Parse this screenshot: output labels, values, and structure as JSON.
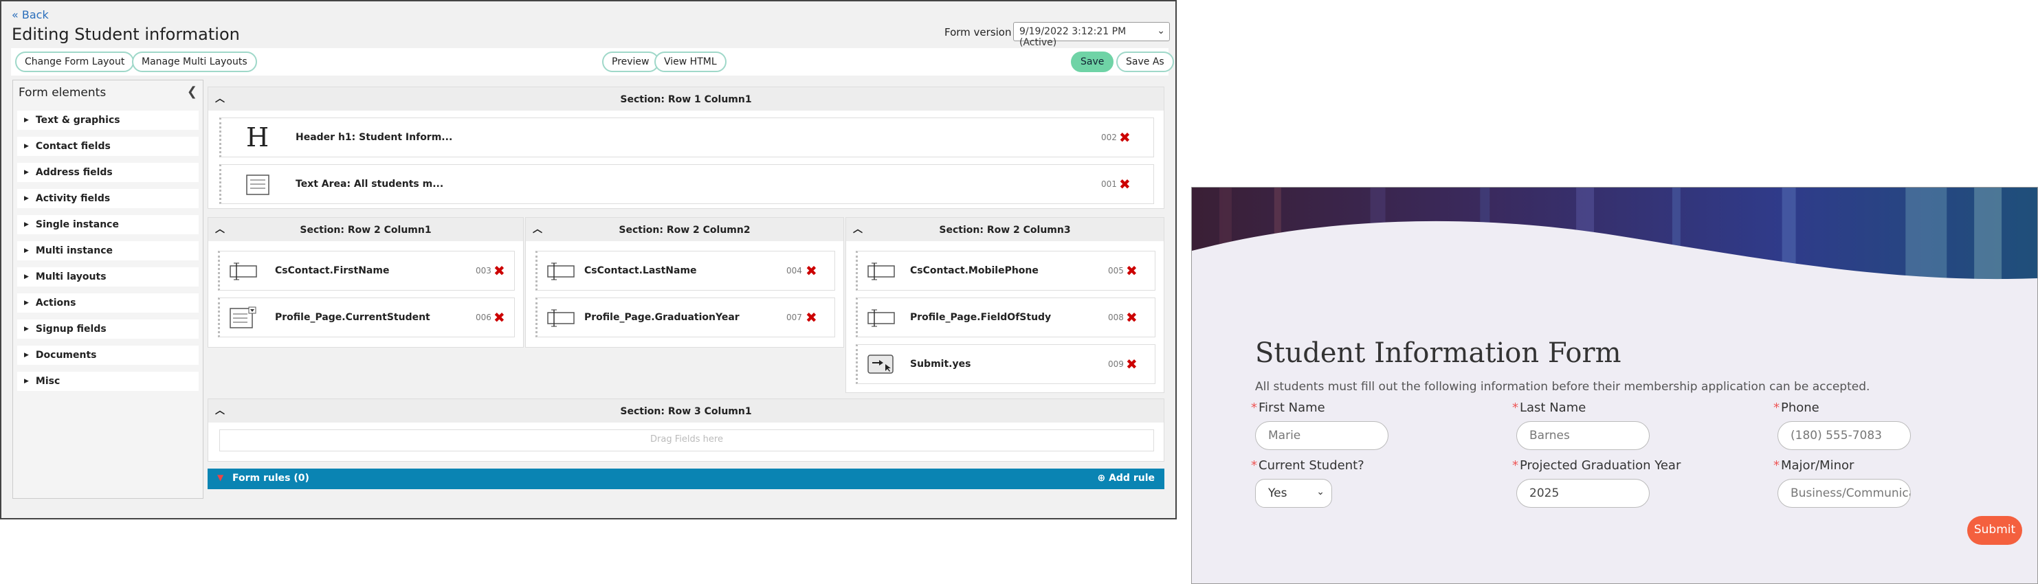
{
  "editor": {
    "back_label": "« Back",
    "title": "Editing Student information",
    "form_version_label": "Form version",
    "form_version_value": "9/19/2022 3:12:21 PM (Active)",
    "toolbar": {
      "change_layout": "Change Form Layout",
      "manage_multi": "Manage Multi Layouts",
      "preview": "Preview",
      "view_html": "View HTML",
      "save": "Save",
      "save_as": "Save As"
    },
    "sidebar": {
      "title": "Form elements",
      "items": [
        "Text & graphics",
        "Contact fields",
        "Address fields",
        "Activity fields",
        "Single instance",
        "Multi instance",
        "Multi layouts",
        "Actions",
        "Signup fields",
        "Documents",
        "Misc"
      ]
    },
    "sections": {
      "row1": {
        "title": "Section: Row 1 Column1",
        "fields": [
          {
            "name": "Header h1: Student Inform...",
            "num": "002",
            "icon": "header-icon"
          },
          {
            "name": "Text Area: All students m...",
            "num": "001",
            "icon": "text-area-icon"
          }
        ]
      },
      "row2col1": {
        "title": "Section: Row 2 Column1",
        "fields": [
          {
            "name": "CsContact.FirstName",
            "num": "003",
            "icon": "text-input-icon"
          },
          {
            "name": "Profile_Page.CurrentStudent",
            "num": "006",
            "icon": "dropdown-icon"
          }
        ]
      },
      "row2col2": {
        "title": "Section: Row 2 Column2",
        "fields": [
          {
            "name": "CsContact.LastName",
            "num": "004",
            "icon": "text-input-icon"
          },
          {
            "name": "Profile_Page.GraduationYear",
            "num": "007",
            "icon": "text-input-icon"
          }
        ]
      },
      "row2col3": {
        "title": "Section: Row 2 Column3",
        "fields": [
          {
            "name": "CsContact.MobilePhone",
            "num": "005",
            "icon": "text-input-icon"
          },
          {
            "name": "Profile_Page.FieldOfStudy",
            "num": "008",
            "icon": "text-input-icon"
          },
          {
            "name": "Submit.yes",
            "num": "009",
            "icon": "submit-icon"
          }
        ]
      },
      "row3": {
        "title": "Section: Row 3 Column1",
        "drag_hint": "Drag Fields here"
      }
    },
    "rules": {
      "label": "Form rules (0)",
      "add": "Add rule"
    }
  },
  "preview": {
    "title": "Student Information Form",
    "description": "All students must fill out the following information before their membership application can be accepted.",
    "fields": {
      "first_name": {
        "label": "First Name",
        "value": "Marie"
      },
      "last_name": {
        "label": "Last Name",
        "value": "Barnes"
      },
      "phone": {
        "label": "Phone",
        "value": "(180) 555-7083"
      },
      "current_student": {
        "label": "Current Student?",
        "value": "Yes"
      },
      "grad_year": {
        "label": "Projected Graduation Year",
        "value": "2025"
      },
      "major": {
        "label": "Major/Minor",
        "value": "Business/Communication"
      }
    },
    "required_mark": "*",
    "submit": "Submit"
  }
}
